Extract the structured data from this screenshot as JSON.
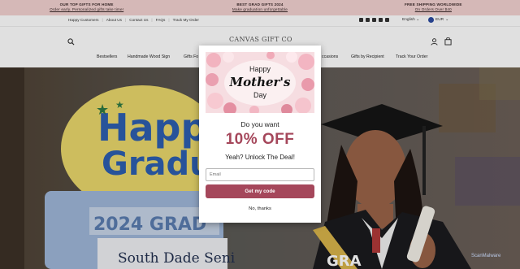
{
  "announcement": [
    {
      "title": "Our top gifts for home",
      "link": "Order early. Personalized gifts take time!"
    },
    {
      "title": "Best grad gifts 2024",
      "link": "Make graduation unforgettable"
    },
    {
      "title": "Free shipping worldwide",
      "link": "On Orders Over $40"
    }
  ],
  "utility_links": [
    "Happy Customers",
    "About Us",
    "Contact Us",
    "FAQs",
    "Track My Order"
  ],
  "language": "English",
  "currency": "EUR",
  "logo_text": "CANVAS GIFT CO",
  "nav": [
    {
      "label": "Bestsellers"
    },
    {
      "label": "Handmade Wood Sign"
    },
    {
      "label": "Gifts Fo"
    },
    {
      "label": "ccasions"
    },
    {
      "label": "Gifts by Recipient"
    },
    {
      "label": "Track Your Order"
    }
  ],
  "hero": {
    "sign_text_1": "Happ",
    "sign_text_2": "Gradu",
    "plate_text": "2024 GRAD",
    "school_text": "South Dade Seni",
    "sash_text": "GRA"
  },
  "popup": {
    "image_text_1": "Happy",
    "image_text_2": "Mother's",
    "image_text_3": "Day",
    "heading": "Do you want",
    "offer": "10% OFF",
    "subheading": "Yeah? Unlock The Deal!",
    "email_placeholder": "Email",
    "cta": "Get my code",
    "decline": "No, thanks"
  },
  "watermark": "ScanMalware"
}
